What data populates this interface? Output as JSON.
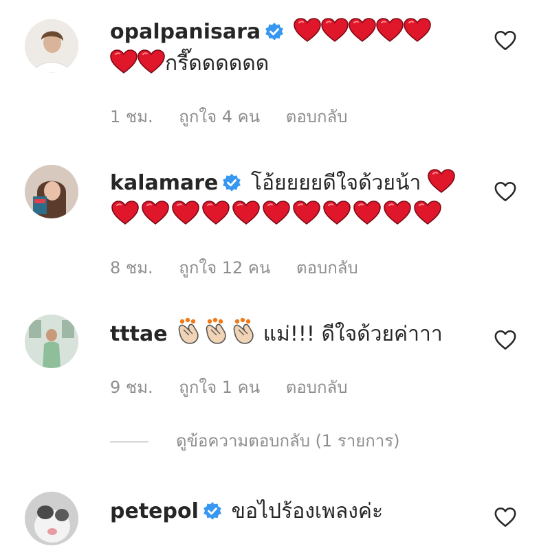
{
  "comments": [
    {
      "username": "opalpanisara",
      "verified": true,
      "text_before": "",
      "text_after": "กรี๊ดดดดดด",
      "time": "1 ชม.",
      "likes": "ถูกใจ 4 คน",
      "reply_label": "ตอบกลับ",
      "avatar_icon": "avatar-photo"
    },
    {
      "username": "kalamare",
      "verified": true,
      "text_before": "โอ้ยยยยดีใจด้วยน้า",
      "text_after": "",
      "time": "8 ชม.",
      "likes": "ถูกใจ 12 คน",
      "reply_label": "ตอบกลับ",
      "avatar_icon": "avatar-photo"
    },
    {
      "username": "tttae",
      "verified": false,
      "text_before": "",
      "text_after": "แม่!!! ดีใจด้วยค่าาา",
      "time": "9 ชม.",
      "likes": "ถูกใจ 1 คน",
      "reply_label": "ตอบกลับ",
      "avatar_icon": "avatar-photo"
    },
    {
      "username": "petepol",
      "verified": true,
      "text_before": "ขอไปร้องเพลงค่ะ",
      "text_after": "",
      "avatar_icon": "avatar-photo"
    }
  ],
  "view_replies_label": "ดูข้อความตอบกลับ (1 รายการ)",
  "colors": {
    "text": "#262626",
    "muted": "#8e8e8e",
    "verified": "#3897f0",
    "heart": "#e0162b"
  },
  "icons": {
    "verified": "verified-badge-icon",
    "heart_emoji": "red-heart-emoji-icon",
    "clap_emoji": "clapping-hands-emoji-icon",
    "like": "heart-outline-icon"
  }
}
